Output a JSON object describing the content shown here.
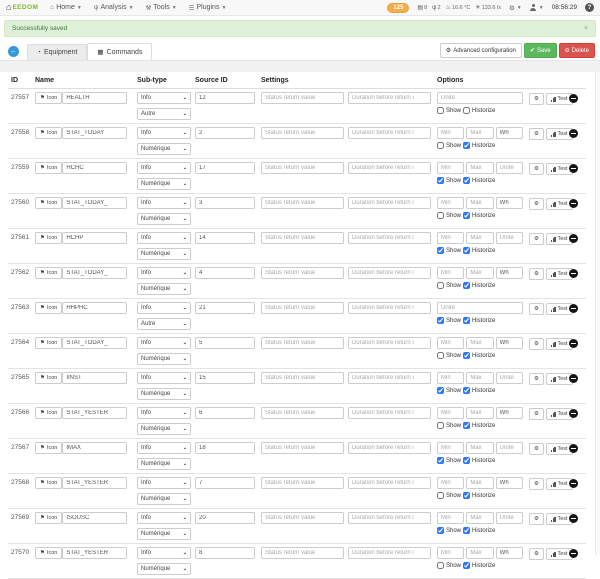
{
  "navbar": {
    "brand": "EEDOM",
    "menus": [
      {
        "label": "Home",
        "icon": "home-icon"
      },
      {
        "label": "Analysis",
        "icon": "analysis-icon"
      },
      {
        "label": "Tools",
        "icon": "tools-icon"
      },
      {
        "label": "Plugins",
        "icon": "plugins-icon"
      }
    ],
    "badge": "125",
    "status": [
      {
        "icon": "messages-icon",
        "value": "8"
      },
      {
        "icon": "usb-icon",
        "value": "2"
      },
      {
        "icon": "temperature-icon",
        "value": "16.6 °C"
      },
      {
        "icon": "brightness-icon",
        "value": "133.6 lx"
      }
    ],
    "time": "08:56:29",
    "help": "?"
  },
  "alert": {
    "text": "Successfully saved",
    "close": "×"
  },
  "tabs": {
    "equipment": "Equipment",
    "commands": "Commands"
  },
  "toolbar": {
    "advanced": "Advanced configuration",
    "save": "Save",
    "delete": "Delete"
  },
  "table": {
    "headers": {
      "id": "ID",
      "name": "Name",
      "subtype": "Sub-type",
      "source": "Source ID",
      "settings": "Settings",
      "options": "Options"
    },
    "labels": {
      "icon": "Icon",
      "show": "Show",
      "historize": "Historize",
      "test": "Test"
    },
    "placeholders": {
      "status": "Status return value",
      "duration": "Duration before return i",
      "min": "Min",
      "max": "Max",
      "unit": "Unité"
    },
    "rows": [
      {
        "id": "27557",
        "name": "HEALTH",
        "type": "Info",
        "subtype": "Autre",
        "source": "12",
        "minmax": false,
        "unit": "",
        "show": false,
        "historize": false
      },
      {
        "id": "27558",
        "name": "STAT_TODAY",
        "type": "Info",
        "subtype": "Numérique",
        "source": "2",
        "minmax": true,
        "unit": "Wh",
        "show": false,
        "historize": true
      },
      {
        "id": "27559",
        "name": "HCHC",
        "type": "Info",
        "subtype": "Numérique",
        "source": "17",
        "minmax": true,
        "unit": "",
        "show": true,
        "historize": true
      },
      {
        "id": "27560",
        "name": "STAT_TODAY_",
        "type": "Info",
        "subtype": "Numérique",
        "source": "3",
        "minmax": true,
        "unit": "Wh",
        "show": false,
        "historize": true
      },
      {
        "id": "27561",
        "name": "HCHP",
        "type": "Info",
        "subtype": "Numérique",
        "source": "14",
        "minmax": true,
        "unit": "",
        "show": true,
        "historize": true
      },
      {
        "id": "27562",
        "name": "STAT_TODAY_",
        "type": "Info",
        "subtype": "Numérique",
        "source": "4",
        "minmax": true,
        "unit": "Wh",
        "show": false,
        "historize": true
      },
      {
        "id": "27563",
        "name": "HHPHC",
        "type": "Info",
        "subtype": "Autre",
        "source": "21",
        "minmax": false,
        "unit": "",
        "show": true,
        "historize": true
      },
      {
        "id": "27564",
        "name": "STAT_TODAY_",
        "type": "Info",
        "subtype": "Numérique",
        "source": "5",
        "minmax": true,
        "unit": "Wh",
        "show": false,
        "historize": true
      },
      {
        "id": "27565",
        "name": "IINST",
        "type": "Info",
        "subtype": "Numérique",
        "source": "15",
        "minmax": true,
        "unit": "",
        "show": true,
        "historize": true
      },
      {
        "id": "27566",
        "name": "STAT_YESTER",
        "type": "Info",
        "subtype": "Numérique",
        "source": "6",
        "minmax": true,
        "unit": "Wh",
        "show": false,
        "historize": true
      },
      {
        "id": "27567",
        "name": "IMAX",
        "type": "Info",
        "subtype": "Numérique",
        "source": "18",
        "minmax": true,
        "unit": "",
        "show": true,
        "historize": true
      },
      {
        "id": "27568",
        "name": "STAT_YESTER",
        "type": "Info",
        "subtype": "Numérique",
        "source": "7",
        "minmax": true,
        "unit": "Wh",
        "show": false,
        "historize": true
      },
      {
        "id": "27569",
        "name": "ISOUSC",
        "type": "Info",
        "subtype": "Numérique",
        "source": "20",
        "minmax": true,
        "unit": "",
        "show": true,
        "historize": true
      },
      {
        "id": "27570",
        "name": "STAT_YESTER",
        "type": "Info",
        "subtype": "Numérique",
        "source": "8",
        "minmax": true,
        "unit": "Wh",
        "show": false,
        "historize": true
      }
    ]
  }
}
